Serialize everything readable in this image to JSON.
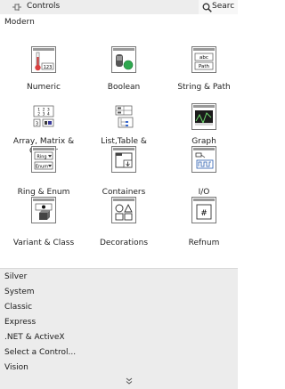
{
  "header": {
    "title": "Controls",
    "search_label": "Searc"
  },
  "section": "Modern",
  "items": [
    {
      "label": "Numeric",
      "icon": "numeric-icon"
    },
    {
      "label": "Boolean",
      "icon": "boolean-icon"
    },
    {
      "label": "String & Path",
      "icon": "string-path-icon",
      "icon_text_1": "abc",
      "icon_text_2": "Path"
    },
    {
      "label": "Array, Matrix &\nCluster",
      "icon": "array-matrix-cluster-icon"
    },
    {
      "label": "List,Table &\nTree",
      "icon": "list-table-tree-icon"
    },
    {
      "label": "Graph",
      "icon": "graph-icon"
    },
    {
      "label": "Ring & Enum",
      "icon": "ring-enum-icon",
      "icon_text_1": "Ring",
      "icon_text_2": "Enum"
    },
    {
      "label": "Containers",
      "icon": "containers-icon"
    },
    {
      "label": "I/O",
      "icon": "io-icon"
    },
    {
      "label": "Variant & Class",
      "icon": "variant-class-icon"
    },
    {
      "label": "Decorations",
      "icon": "decorations-icon"
    },
    {
      "label": "Refnum",
      "icon": "refnum-icon",
      "icon_text_1": "#"
    }
  ],
  "categories": [
    "Silver",
    "System",
    "Classic",
    "Express",
    ".NET & ActiveX",
    "Select a Control...",
    "Vision"
  ],
  "colors": {
    "header_bg": "#ededed",
    "category_bg": "#ececec",
    "accent_green": "#2fa84f",
    "icon_red": "#d94040"
  }
}
